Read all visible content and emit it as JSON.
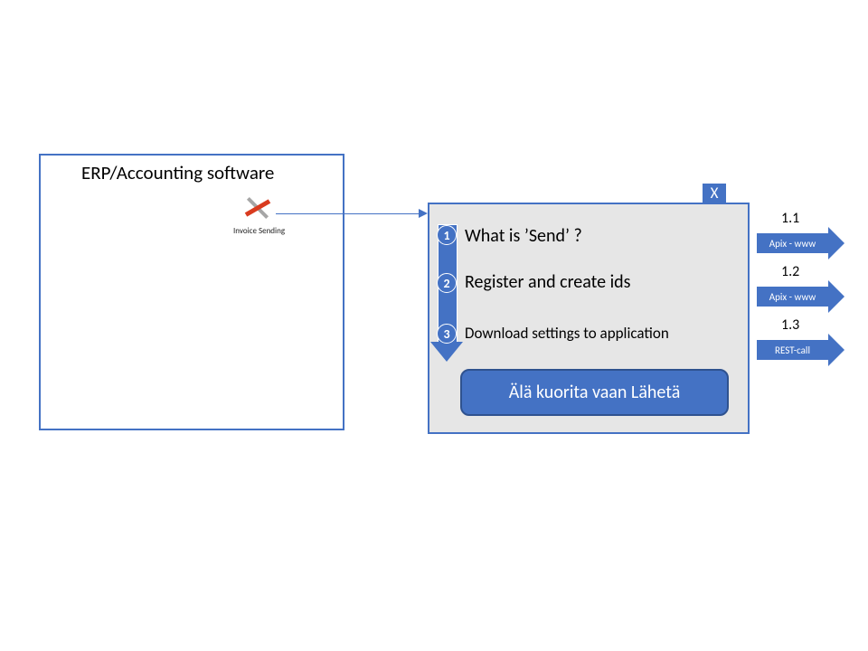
{
  "erp": {
    "title": "ERP/Accounting software",
    "invoice_label": "Invoice Sending"
  },
  "panel": {
    "close_label": "X",
    "steps": [
      {
        "num": "1",
        "text": "What is ’Send’ ?"
      },
      {
        "num": "2",
        "text": "Register and create ids"
      },
      {
        "num": "3",
        "text": "Download settings to application"
      }
    ],
    "cta": "Älä kuorita vaan Lähetä"
  },
  "ext": [
    {
      "label": "1.1",
      "text": "Apix - www"
    },
    {
      "label": "1.2",
      "text": "Apix - www"
    },
    {
      "label": "1.3",
      "text": "REST-call"
    }
  ]
}
